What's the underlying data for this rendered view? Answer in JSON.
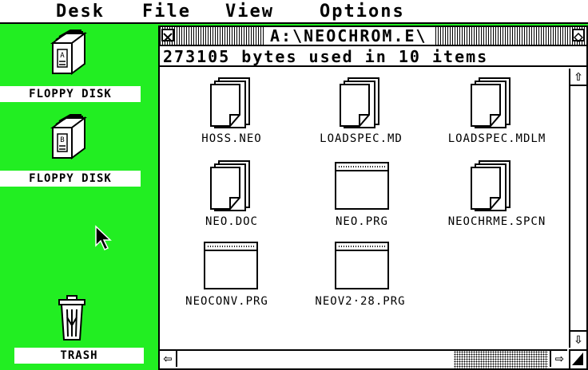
{
  "menubar": {
    "items": [
      "Desk",
      "File",
      "View",
      "Options"
    ]
  },
  "desktop": {
    "background_color": "#22ee22",
    "icons": [
      {
        "label": "FLOPPY DISK",
        "letter": "A"
      },
      {
        "label": "FLOPPY DISK",
        "letter": "B"
      },
      {
        "label": "TRASH"
      }
    ]
  },
  "window": {
    "title": "A:\\NEOCHROM.E\\",
    "info": "273105 bytes used in 10 items",
    "files": [
      {
        "name": "HOSS.NEO",
        "type": "document"
      },
      {
        "name": "LOADSPEC.MD",
        "type": "document"
      },
      {
        "name": "LOADSPEC.MDLM",
        "type": "document"
      },
      {
        "name": "NEO.DOC",
        "type": "document"
      },
      {
        "name": "NEO.PRG",
        "type": "program"
      },
      {
        "name": "NEOCHRME.SPCN",
        "type": "document"
      },
      {
        "name": "NEOCONV.PRG",
        "type": "program"
      },
      {
        "name": "NEOV2·28.PRG",
        "type": "program"
      }
    ],
    "scroll": {
      "up": "⇧",
      "down": "⇩",
      "left": "⇦",
      "right": "⇨"
    }
  }
}
